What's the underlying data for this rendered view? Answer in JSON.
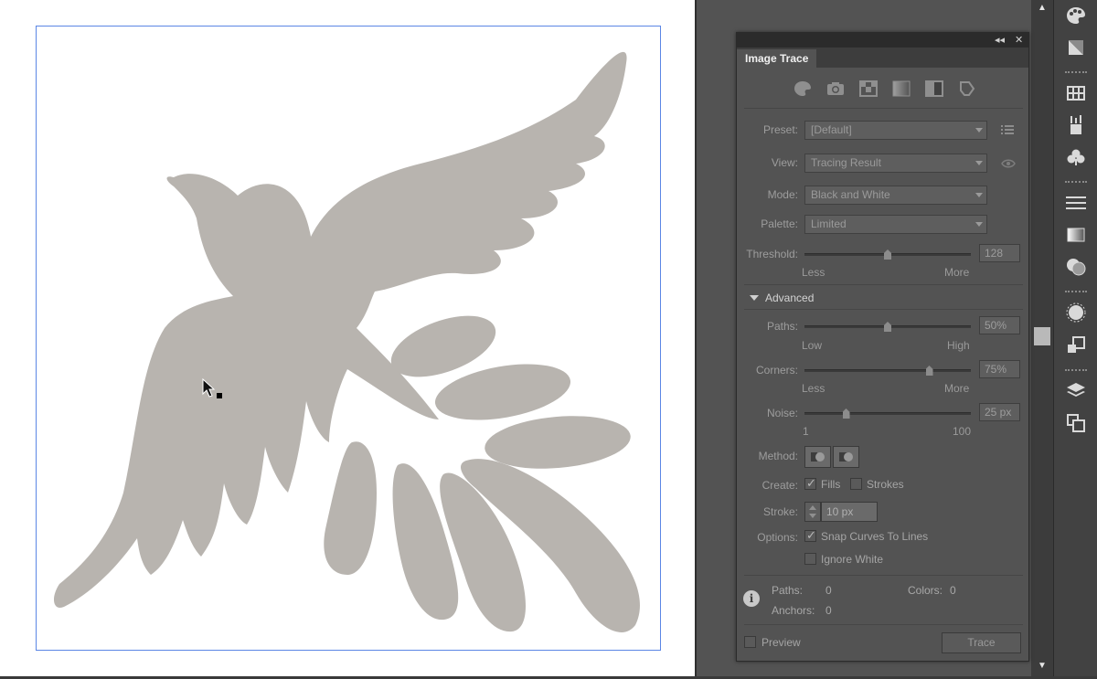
{
  "panel": {
    "title": "Image Trace",
    "preset_label": "Preset:",
    "preset_value": "[Default]",
    "view_label": "View:",
    "view_value": "Tracing Result",
    "mode_label": "Mode:",
    "mode_value": "Black and White",
    "palette_label": "Palette:",
    "palette_value": "Limited",
    "threshold_label": "Threshold:",
    "threshold_value": "128",
    "threshold_min": "Less",
    "threshold_max": "More",
    "advanced_label": "Advanced",
    "paths_label": "Paths:",
    "paths_value": "50%",
    "paths_min": "Low",
    "paths_max": "High",
    "corners_label": "Corners:",
    "corners_value": "75%",
    "corners_min": "Less",
    "corners_max": "More",
    "noise_label": "Noise:",
    "noise_value": "25 px",
    "noise_min": "1",
    "noise_max": "100",
    "method_label": "Method:",
    "create_label": "Create:",
    "fills_label": "Fills",
    "fills_checked": true,
    "strokes_label": "Strokes",
    "strokes_checked": false,
    "stroke_label": "Stroke:",
    "stroke_value": "10 px",
    "options_label": "Options:",
    "snap_label": "Snap Curves To Lines",
    "snap_checked": true,
    "ignore_white_label": "Ignore White",
    "ignore_white_checked": false,
    "stats": {
      "paths_label": "Paths:",
      "paths_value": "0",
      "colors_label": "Colors:",
      "colors_value": "0",
      "anchors_label": "Anchors:",
      "anchors_value": "0"
    },
    "preview_label": "Preview",
    "preview_checked": false,
    "trace_button": "Trace"
  },
  "sliders": {
    "threshold_fraction": 0.5,
    "paths_fraction": 0.5,
    "corners_fraction": 0.75,
    "noise_fraction": 0.25
  },
  "colors": {
    "artboard_border": "#5b86e5",
    "artwork_fill": "#b8b4af",
    "panel_bg": "#535353"
  },
  "preset_icons": [
    "auto-color-icon",
    "high-fidelity-photo-icon",
    "low-fidelity-photo-icon",
    "grayscale-icon",
    "black-and-white-icon",
    "outline-icon"
  ],
  "dock_icons": [
    "color-palette-icon",
    "color-guide-icon",
    "swatches-icon",
    "brushes-icon",
    "symbols-icon",
    "stroke-icon",
    "gradient-icon",
    "transparency-icon",
    "appearance-icon",
    "graphic-styles-icon",
    "layers-icon",
    "artboards-icon"
  ]
}
